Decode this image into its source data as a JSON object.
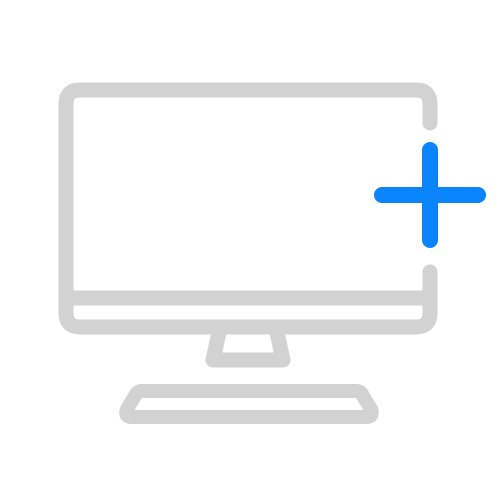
{
  "icon": {
    "name": "add-computer-icon",
    "parts": [
      "monitor",
      "stand",
      "keyboard",
      "plus"
    ]
  },
  "colors": {
    "outline": "#d2d2d2",
    "accent": "#0a84ff",
    "background": "#ffffff"
  }
}
